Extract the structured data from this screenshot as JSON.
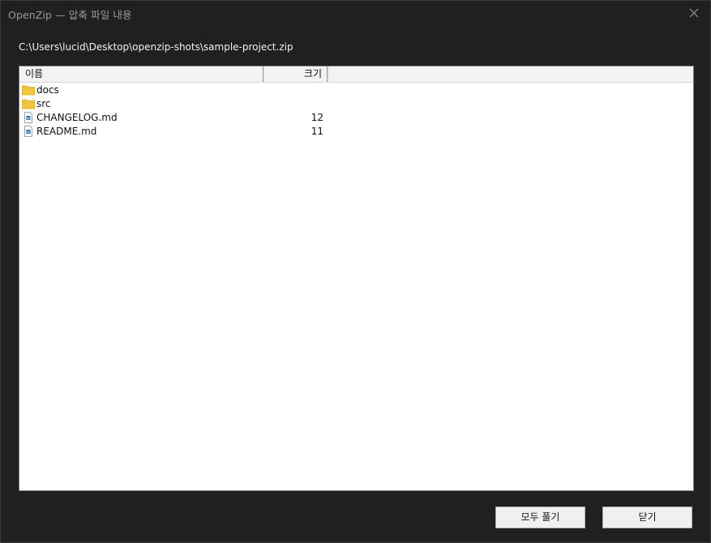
{
  "window": {
    "title": "OpenZip — 압축 파일 내용"
  },
  "archive_path": "C:\\Users\\lucid\\Desktop\\openzip-shots\\sample-project.zip",
  "list": {
    "columns": {
      "name": "이름",
      "size": "크기"
    },
    "rows": [
      {
        "name": "docs",
        "size": "",
        "icon": "folder-icon"
      },
      {
        "name": "src",
        "size": "",
        "icon": "folder-icon"
      },
      {
        "name": "CHANGELOG.md",
        "size": "12",
        "icon": "file-icon"
      },
      {
        "name": "README.md",
        "size": "11",
        "icon": "file-icon"
      }
    ]
  },
  "buttons": {
    "extract_all": "모두 풀기",
    "close": "닫기"
  },
  "colors": {
    "window_bg": "#202020",
    "folder": "#f4c542",
    "file_accent": "#2f6fb5"
  }
}
